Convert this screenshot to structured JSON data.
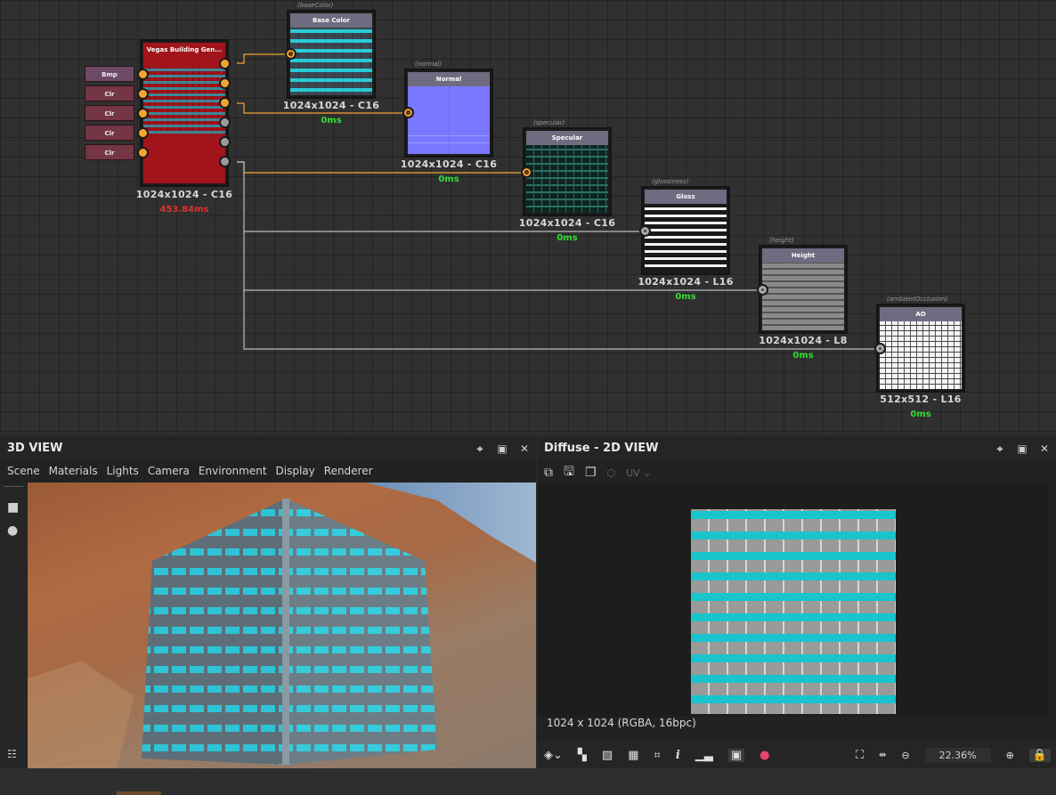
{
  "graph": {
    "generator": {
      "title": "Vegas Building Gen...",
      "resolution": "1024x1024 - C16",
      "time": "453.84ms",
      "inputs": [
        "Bmp",
        "Clr",
        "Clr",
        "Clr",
        "Clr"
      ]
    },
    "outputs": [
      {
        "tag": "(baseColor)",
        "title": "Base Color",
        "resolution": "1024x1024 - C16",
        "time": "0ms"
      },
      {
        "tag": "(normal)",
        "title": "Normal",
        "resolution": "1024x1024 - C16",
        "time": "0ms"
      },
      {
        "tag": "(specular)",
        "title": "Specular",
        "resolution": "1024x1024 - C16",
        "time": "0ms"
      },
      {
        "tag": "(glossiness)",
        "title": "Gloss",
        "resolution": "1024x1024 - L16",
        "time": "0ms"
      },
      {
        "tag": "(height)",
        "title": "Height",
        "resolution": "1024x1024 - L8",
        "time": "0ms"
      },
      {
        "tag": "(ambientOcclusion)",
        "title": "AO",
        "resolution": "512x512 - L16",
        "time": "0ms"
      }
    ],
    "colors": {
      "wire_orange": "#f2a431",
      "wire_gray": "#bdbdbd",
      "generator_body": "#a1141a"
    }
  },
  "view3d": {
    "title": "3D VIEW",
    "menu": [
      "Scene",
      "Materials",
      "Lights",
      "Camera",
      "Environment",
      "Display",
      "Renderer"
    ]
  },
  "view2d": {
    "title": "Diffuse - 2D VIEW",
    "channel_select": "UV",
    "info": "1024 x 1024 (RGBA, 16bpc)",
    "zoom": "22.36%"
  }
}
